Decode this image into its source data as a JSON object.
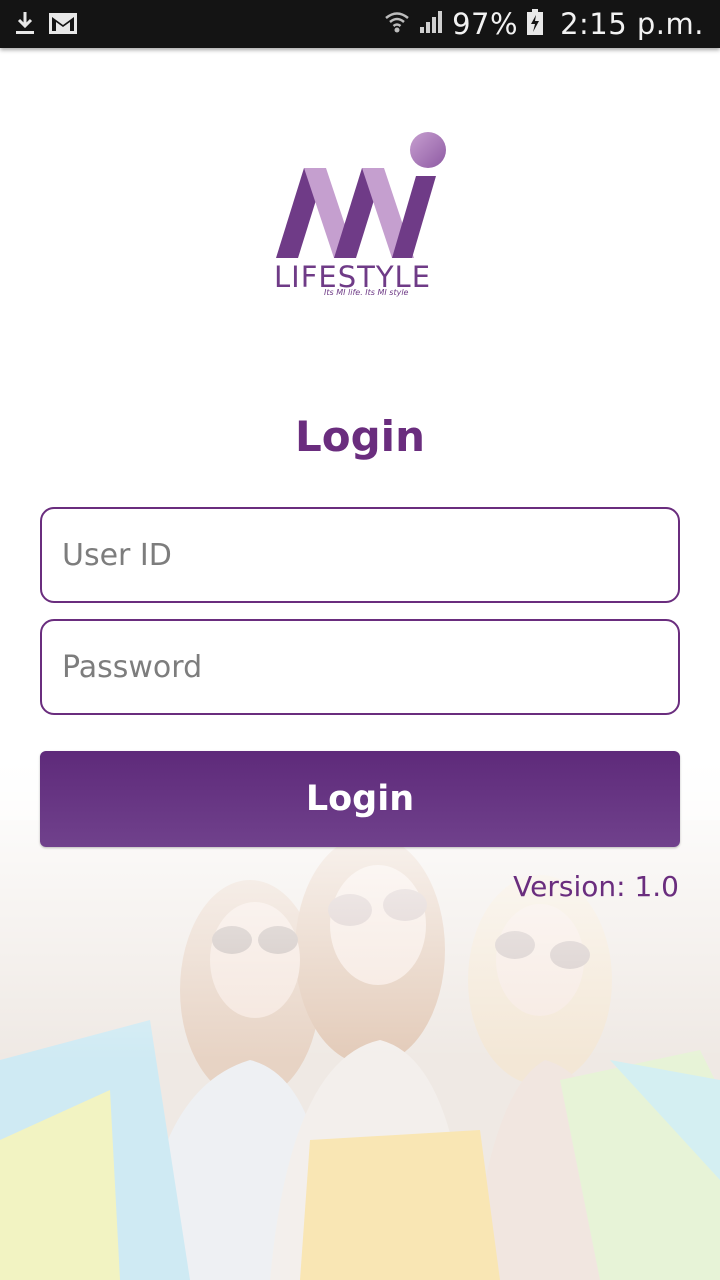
{
  "status_bar": {
    "battery": "97%",
    "time": "2:15 p.m.",
    "left_icons": [
      "download-icon",
      "gmail-icon"
    ],
    "right_icons": [
      "wifi-icon",
      "signal-icon",
      "battery-charging-icon"
    ]
  },
  "logo": {
    "wordmark": "LIFESTYLE",
    "tagline": "Its MI life. Its MI style",
    "colors": {
      "dark": "#6f3b87",
      "light": "#c59fcf"
    }
  },
  "login": {
    "title": "Login",
    "user_placeholder": "User ID",
    "password_placeholder": "Password",
    "button_label": "Login",
    "version": "Version: 1.0"
  },
  "colors": {
    "accent": "#6a2d7e",
    "status_bar": "#141414"
  }
}
